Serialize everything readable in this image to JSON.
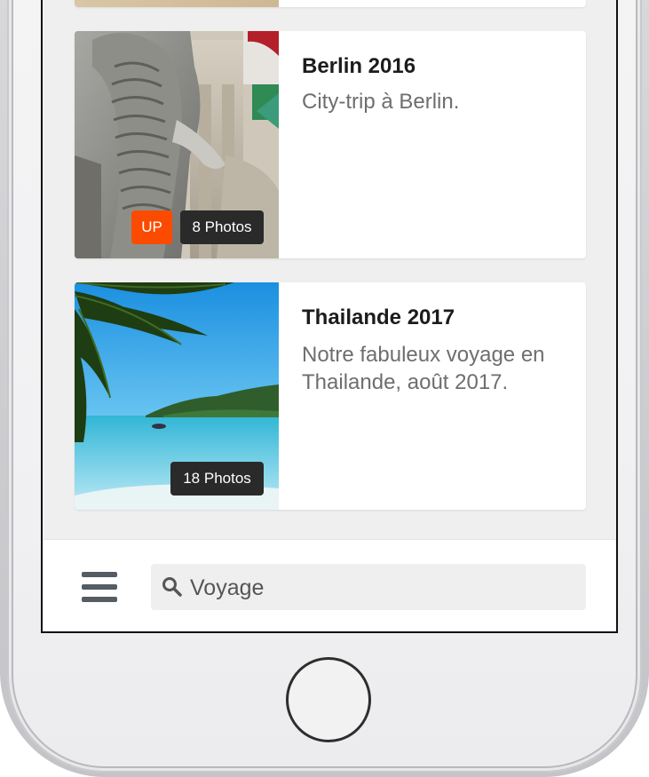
{
  "albums": [
    {
      "title": "Berlin 2016",
      "description": "City-trip à Berlin.",
      "photos_badge": "8 Photos",
      "up_badge": "UP"
    },
    {
      "title": "Thailande 2017",
      "description": "Notre fabuleux voyage en Thailande, août 2017.",
      "photos_badge": "18 Photos"
    }
  ],
  "bottom_bar": {
    "search_value": "Voyage",
    "menu_icon": "hamburger-menu-icon",
    "search_icon": "search-icon"
  },
  "colors": {
    "up_badge": "#fb4b00",
    "photo_badge": "#2a2a2a",
    "screen_background": "#efefef"
  }
}
